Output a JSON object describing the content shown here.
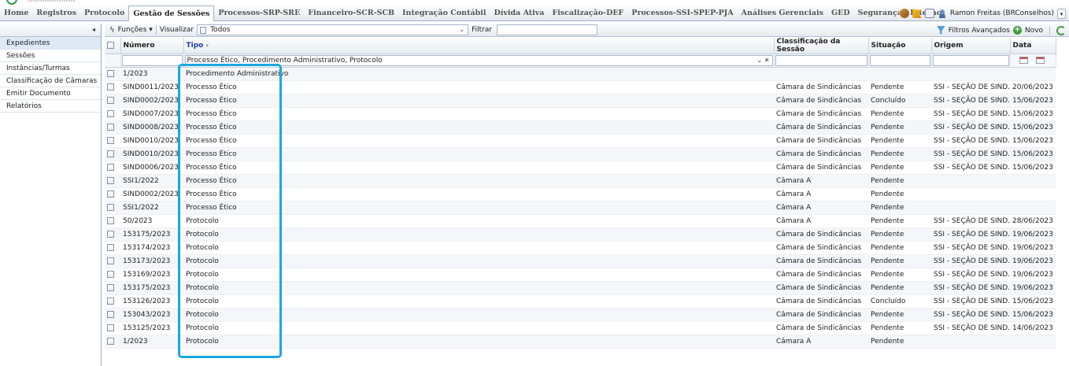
{
  "menu": {
    "tabs": [
      "Home",
      "Registros",
      "Protocolo",
      "Gestão de Sessões",
      "Processos-SRP-SRE",
      "Financeiro-SCR-SCB",
      "Integração Contábil",
      "Dívida Ativa",
      "Fiscalização-DEF",
      "Processos-SSI-SPEP-PJA",
      "Análises Gerenciais",
      "GED",
      "Segurança",
      "Interno"
    ],
    "active_tab": "Gestão de Sessões",
    "user": "Ramon Freitas (BRConselhos)"
  },
  "sidebar": {
    "items": [
      "Expedientes",
      "Sessões",
      "Instâncias/Turmas",
      "Classificação de Câmaras",
      "Emitir Documento",
      "Relatórios"
    ],
    "selected": "Expedientes"
  },
  "toolbar": {
    "functions_label": "Funções",
    "view_label": "Visualizar",
    "view_value": "Todos",
    "filter_label": "Filtrar",
    "advanced_filters_label": "Filtros Avançados",
    "new_label": "Novo"
  },
  "grid": {
    "columns": [
      "Número",
      "Tipo",
      "Classificação da Sessão",
      "Situação",
      "Origem",
      "Data"
    ],
    "type_filter_value": "Processo Ético, Procedimento Administrativo, Protocolo",
    "rows": [
      [
        "1/2023",
        "Procedimento Administrativo",
        "",
        "",
        "",
        ""
      ],
      [
        "SIND0011/2023",
        "Processo Ético",
        "Câmara de Sindicâncias",
        "Pendente",
        "SSI - SEÇÃO DE SIND...",
        "20/06/2023"
      ],
      [
        "SIND0002/2023",
        "Processo Ético",
        "Câmara de Sindicâncias",
        "Concluído",
        "SSI - SEÇÃO DE SIND...",
        "15/06/2023"
      ],
      [
        "SIND0007/2023",
        "Processo Ético",
        "Câmara de Sindicâncias",
        "Pendente",
        "SSI - SEÇÃO DE SIND...",
        "15/06/2023"
      ],
      [
        "SIND0008/2023",
        "Processo Ético",
        "Câmara de Sindicâncias",
        "Pendente",
        "SSI - SEÇÃO DE SIND...",
        "15/06/2023"
      ],
      [
        "SIND0010/2023",
        "Processo Ético",
        "Câmara de Sindicâncias",
        "Pendente",
        "SSI - SEÇÃO DE SIND...",
        "15/06/2023"
      ],
      [
        "SIND0010/2023",
        "Processo Ético",
        "Câmara de Sindicâncias",
        "Pendente",
        "SSI - SEÇÃO DE SIND...",
        "15/06/2023"
      ],
      [
        "SIND0006/2023",
        "Processo Ético",
        "Câmara de Sindicâncias",
        "Pendente",
        "SSI - SEÇÃO DE SIND...",
        "15/06/2023"
      ],
      [
        "SSI1/2022",
        "Processo Ético",
        "Câmara A",
        "Pendente",
        "",
        ""
      ],
      [
        "SIND0002/2023",
        "Processo Ético",
        "Câmara A",
        "Pendente",
        "",
        ""
      ],
      [
        "SSI1/2022",
        "Processo Ético",
        "Câmara A",
        "Pendente",
        "",
        ""
      ],
      [
        "50/2023",
        "Protocolo",
        "Câmara A",
        "Pendente",
        "SSI - SEÇÃO DE SIND...",
        "28/06/2023"
      ],
      [
        "153175/2023",
        "Protocolo",
        "Câmara de Sindicâncias",
        "Pendente",
        "SSI - SEÇÃO DE SIND...",
        "19/06/2023"
      ],
      [
        "153174/2023",
        "Protocolo",
        "Câmara de Sindicâncias",
        "Pendente",
        "SSI - SEÇÃO DE SIND...",
        "19/06/2023"
      ],
      [
        "153173/2023",
        "Protocolo",
        "Câmara de Sindicâncias",
        "Pendente",
        "SSI - SEÇÃO DE SIND...",
        "19/06/2023"
      ],
      [
        "153169/2023",
        "Protocolo",
        "Câmara de Sindicâncias",
        "Pendente",
        "SSI - SEÇÃO DE SIND...",
        "19/06/2023"
      ],
      [
        "153175/2023",
        "Protocolo",
        "Câmara de Sindicâncias",
        "Pendente",
        "SSI - SEÇÃO DE SIND...",
        "19/06/2023"
      ],
      [
        "153126/2023",
        "Protocolo",
        "Câmara de Sindicâncias",
        "Concluído",
        "SSI - SEÇÃO DE SIND...",
        "15/06/2023"
      ],
      [
        "153043/2023",
        "Protocolo",
        "Câmara de Sindicâncias",
        "Pendente",
        "SSI - SEÇÃO DE SIND...",
        "15/06/2023"
      ],
      [
        "153125/2023",
        "Protocolo",
        "Câmara de Sindicâncias",
        "Pendente",
        "SSI - SEÇÃO DE SIND...",
        "14/06/2023"
      ],
      [
        "1/2023",
        "Protocolo",
        "Câmara A",
        "Pendente",
        "",
        ""
      ]
    ]
  },
  "colors": {
    "highlight": "#1aa7e0",
    "sorted_header": "#1a3e9c"
  },
  "icons": [
    "tools-icon",
    "flag-icon",
    "home-icon",
    "user-icon",
    "bolt-icon",
    "document-icon",
    "funnel-icon",
    "plus-icon",
    "refresh-icon",
    "calendar-icon"
  ]
}
